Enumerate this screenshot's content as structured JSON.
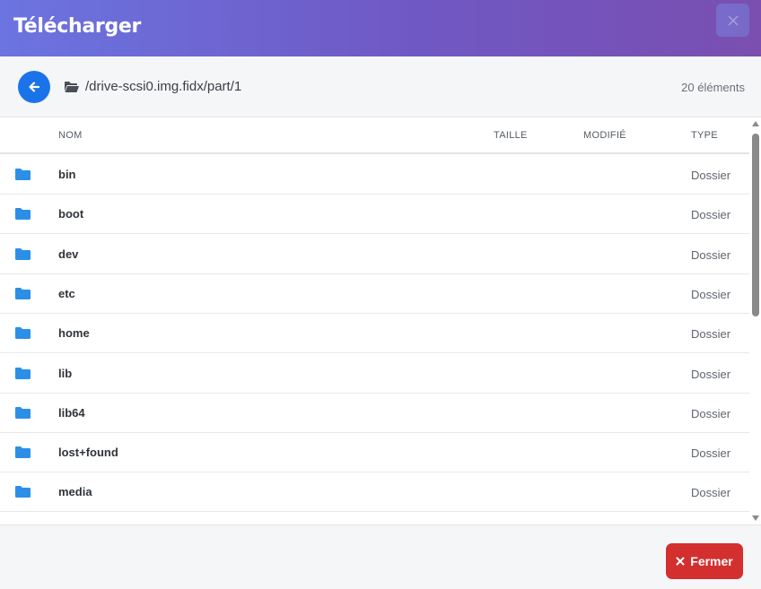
{
  "dialog": {
    "title": "Télécharger",
    "close_icon": "close-icon"
  },
  "pathbar": {
    "path": "/drive-scsi0.img.fidx/part/1",
    "count": "20 éléments"
  },
  "table": {
    "columns": [
      "NOM",
      "TAILLE",
      "MODIFIÉ",
      "TYPE"
    ],
    "rows": [
      {
        "name": "bin",
        "type": "Dossier"
      },
      {
        "name": "boot",
        "type": "Dossier"
      },
      {
        "name": "dev",
        "type": "Dossier"
      },
      {
        "name": "etc",
        "type": "Dossier"
      },
      {
        "name": "home",
        "type": "Dossier"
      },
      {
        "name": "lib",
        "type": "Dossier"
      },
      {
        "name": "lib64",
        "type": "Dossier"
      },
      {
        "name": "lost+found",
        "type": "Dossier"
      },
      {
        "name": "media",
        "type": "Dossier"
      }
    ]
  },
  "footer": {
    "close_label": "Fermer"
  },
  "colors": {
    "header_gradient_start": "#6b74e0",
    "header_gradient_end": "#7a4fb0",
    "accent": "#1a73e8",
    "folder": "#2b8fe8",
    "danger": "#d32f2f"
  }
}
